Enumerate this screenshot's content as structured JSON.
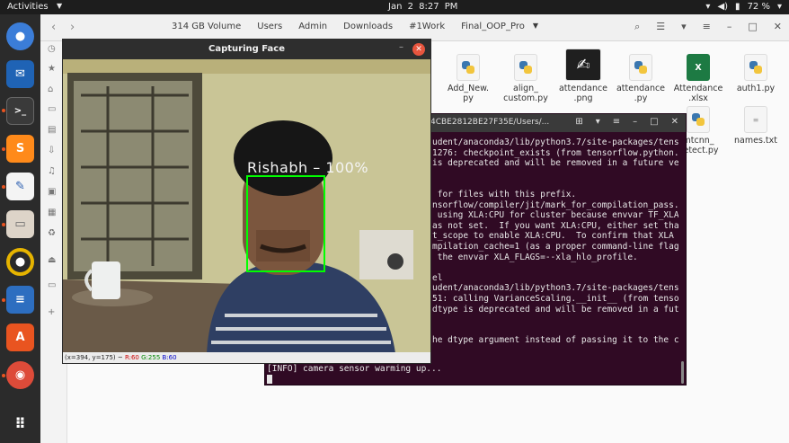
{
  "topbar": {
    "activities": "Activities",
    "clock": "Jan 2  8:27 PM",
    "battery": "72 %"
  },
  "file_manager": {
    "breadcrumbs": [
      "314 GB Volume",
      "Users",
      "Admin",
      "Downloads",
      "#1Work",
      "Final_OOP_Pro"
    ],
    "files": [
      {
        "name": "Add_New.\npy",
        "icon": "python-file-icon"
      },
      {
        "name": "align_\ncustom.py",
        "icon": "python-file-icon"
      },
      {
        "name": "attendance\n.png",
        "icon": "image-file-icon"
      },
      {
        "name": "attendance\n.py",
        "icon": "python-file-icon"
      },
      {
        "name": "Attendance\n.xlsx",
        "icon": "excel-file-icon"
      },
      {
        "name": "auth1.py",
        "icon": "python-file-icon"
      },
      {
        "name": "mtcnn_\ndetect.py",
        "icon": "python-file-icon"
      },
      {
        "name": "names.txt",
        "icon": "text-file-icon"
      }
    ]
  },
  "terminal": {
    "title": "4CBE2812BE27F35E/Users/...",
    "lines": [
      "udent/anaconda3/lib/python3.7/site-packages/tens",
      "1276: checkpoint_exists (from tensorflow.python.",
      "is deprecated and will be removed in a future ve",
      "",
      "",
      " for files with this prefix.",
      "nsorflow/compiler/jit/mark_for_compilation_pass.",
      " using XLA:CPU for cluster because envvar TF_XLA",
      "as not set.  If you want XLA:CPU, either set tha",
      "t_scope to enable XLA:CPU.  To confirm that XLA",
      "mpilation_cache=1 (as a proper command-line flag",
      " the envvar XLA_FLAGS=--xla_hlo_profile.",
      "",
      "el",
      "udent/anaconda3/lib/python3.7/site-packages/tens",
      "51: calling VarianceScaling.__init__ (from tenso",
      "dtype is deprecated and will be removed in a fut",
      "",
      "",
      "he dtype argument instead of passing it to the c"
    ],
    "last_line": "[INFO] camera sensor warming up..."
  },
  "capture_window": {
    "title": "Capturing Face",
    "face_label": "Rishabh  – 100%",
    "status_prefix": "(x=394, y=175) ~ ",
    "status_r": "R:60",
    "status_g": "G:255",
    "status_b": "B:60"
  }
}
